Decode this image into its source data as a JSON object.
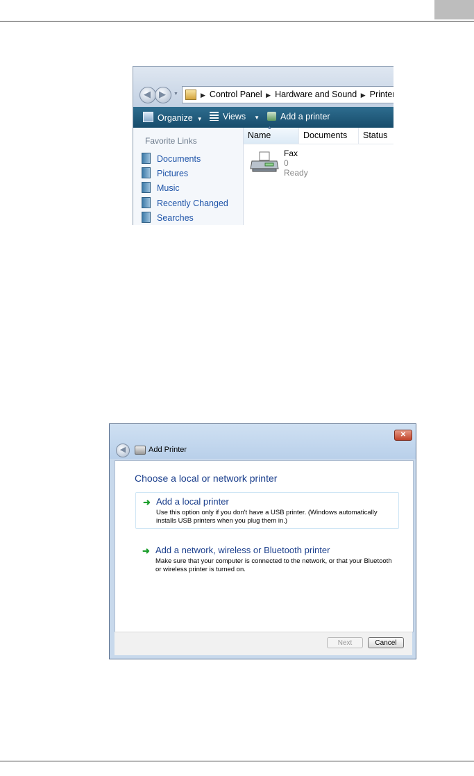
{
  "explorer": {
    "breadcrumbs": [
      "Control Panel",
      "Hardware and Sound",
      "Printers"
    ],
    "toolbar": {
      "organize": "Organize",
      "views": "Views",
      "add_printer": "Add a printer"
    },
    "sidebar": {
      "title": "Favorite Links",
      "items": [
        "Documents",
        "Pictures",
        "Music",
        "Recently Changed",
        "Searches"
      ]
    },
    "columns": [
      "Name",
      "Documents",
      "Status"
    ],
    "item": {
      "name": "Fax",
      "documents": "0",
      "status": "Ready"
    }
  },
  "dialog": {
    "title": "Add Printer",
    "heading": "Choose a local or network printer",
    "options": [
      {
        "title": "Add a local printer",
        "description": "Use this option only if you don't have a USB printer. (Windows automatically installs USB printers when you plug them in.)"
      },
      {
        "title": "Add a network, wireless or Bluetooth printer",
        "description": "Make sure that your computer is connected to the network, or that your Bluetooth or wireless printer is turned on."
      }
    ],
    "buttons": {
      "next": "Next",
      "cancel": "Cancel"
    }
  }
}
